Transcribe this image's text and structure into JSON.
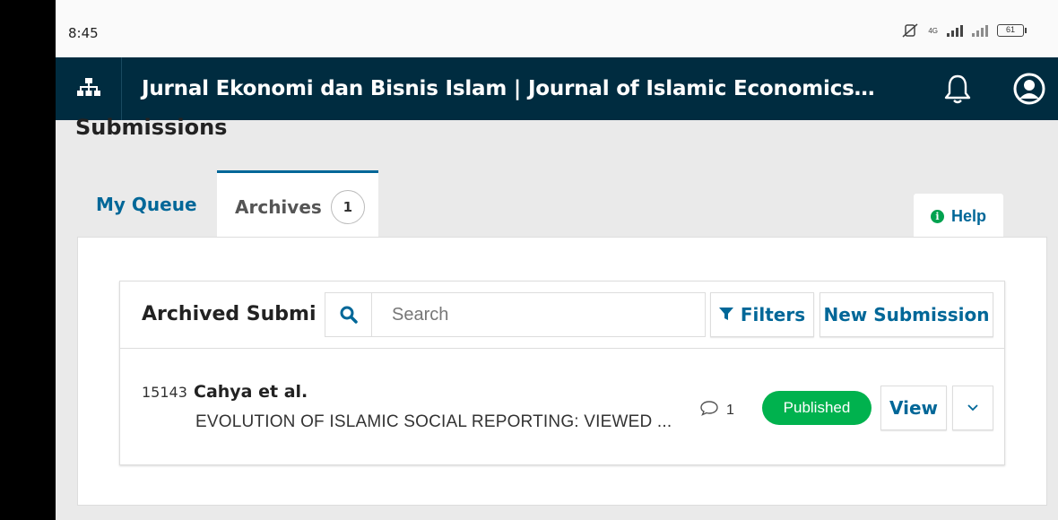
{
  "status_bar": {
    "time": "8:45",
    "network_label": "4G",
    "battery_level": "61",
    "icons": [
      "mute-icon",
      "signal-icon",
      "signal-icon",
      "battery-icon"
    ]
  },
  "app_header": {
    "journal_title": "Jurnal Ekonomi dan Bisnis Islam | Journal of Islamic Economics and B...",
    "icons": [
      "sitemap-icon",
      "bell-icon",
      "user-circle-icon"
    ]
  },
  "page": {
    "heading": "Submissions"
  },
  "tabs": [
    {
      "label": "My Queue",
      "active": false
    },
    {
      "label": "Archives",
      "count": "1",
      "active": true
    }
  ],
  "help": {
    "label": "Help",
    "icon": "info-icon"
  },
  "list_panel": {
    "title": "Archived Submi",
    "search_placeholder": "Search",
    "filters_label": "Filters",
    "new_submission_label": "New Submission"
  },
  "submissions": [
    {
      "id": "15143",
      "authors": "Cahya et al.",
      "title": "EVOLUTION OF ISLAMIC SOCIAL REPORTING: VIEWED ...",
      "comment_count": "1",
      "status": "Published",
      "view_label": "View"
    }
  ],
  "colors": {
    "header_bg": "#002c40",
    "link": "#006798",
    "published_badge": "#00b24e",
    "help_icon": "#00a24f"
  }
}
